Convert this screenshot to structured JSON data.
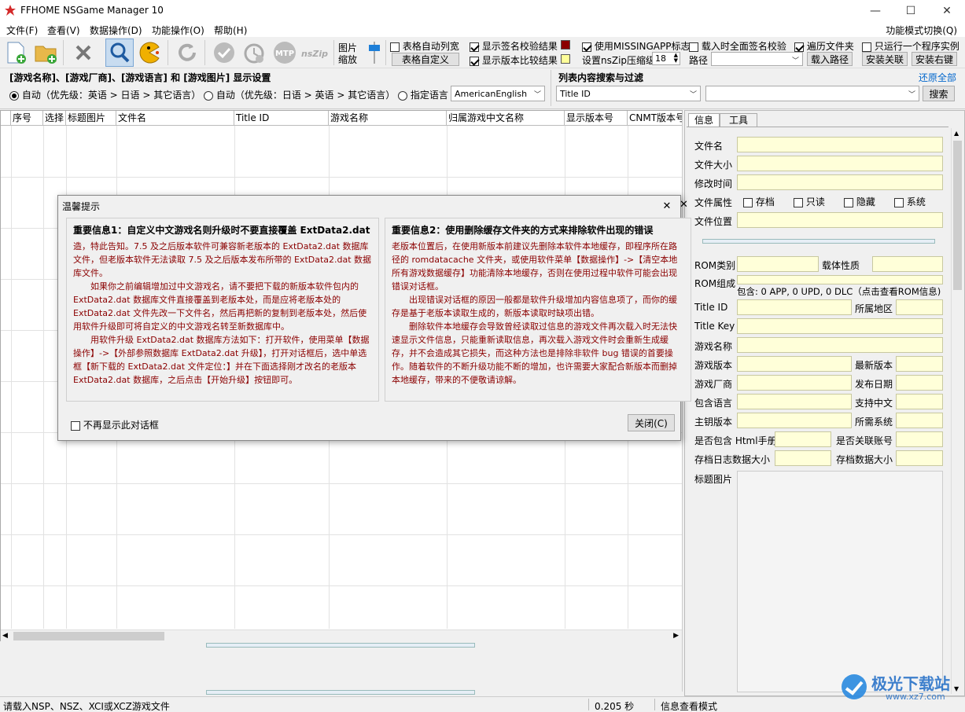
{
  "window": {
    "title": "FFHOME NSGame Manager 10",
    "minimize": "—",
    "maximize": "☐",
    "close": "✕"
  },
  "menu": {
    "items": [
      "文件(F)",
      "查看(V)",
      "数据操作(D)",
      "功能操作(O)",
      "帮助(H)"
    ],
    "mode_switch": "功能模式切换(Q)"
  },
  "toolbar": {
    "image_zoom_label_1": "图片",
    "image_zoom_label_2": "缩放",
    "auto_col_width": "表格自动列宽",
    "table_custom": "表格自定义",
    "show_sig_check": "显示签名校验结果",
    "show_version_compare": "显示版本比较结果",
    "use_missingapp": "使用MISSINGAPP标志",
    "nszip_level_label": "设置nsZip压缩级",
    "nszip_level_value": "18",
    "full_sig_check": "载入时全面签名校验",
    "traverse_folder": "遍历文件夹",
    "path_label": "路径",
    "load_path": "载入路径",
    "single_instance": "只运行一个程序实例",
    "install_assoc": "安装关联",
    "install_right_key": "安装右键",
    "colors": {
      "sig_box": "#8b0000",
      "ver_box": "#ffff99"
    }
  },
  "settings": {
    "display_title": "[游戏名称]、[游戏厂商]、[游戏语言] 和 [游戏图片] 显示设置",
    "radio_auto1": "自动（优先级：英语 > 日语 > 其它语言）",
    "radio_auto2": "自动（优先级：日语 > 英语 > 其它语言）",
    "radio_specify": "指定语言",
    "language_value": "AmericanEnglish",
    "search_title": "列表内容搜索与过滤",
    "restore_all": "还原全部",
    "search_field": "Title ID",
    "search_button": "搜索"
  },
  "table": {
    "columns": [
      "序号",
      "选择",
      "标题图片",
      "文件名",
      "Title ID",
      "游戏名称",
      "归属游戏中文名称",
      "显示版本号",
      "CNMT版本号"
    ]
  },
  "right_panel": {
    "tabs": [
      "信息",
      "工具"
    ],
    "file_name": "文件名",
    "file_size": "文件大小",
    "modified_time": "修改时间",
    "file_attr": "文件属性",
    "attr_archive": "存档",
    "attr_readonly": "只读",
    "attr_hidden": "隐藏",
    "attr_system": "系统",
    "file_location": "文件位置",
    "rom_type": "ROM类别",
    "media_type": "载体性质",
    "rom_composition": "ROM组成",
    "rom_contains": "包含: 0 APP, 0 UPD, 0 DLC（点击查看ROM信息)",
    "title_id": "Title ID",
    "region": "所属地区",
    "title_key": "Title Key",
    "game_name": "游戏名称",
    "game_version": "游戏版本",
    "latest_version": "最新版本",
    "game_vendor": "游戏厂商",
    "release_date": "发布日期",
    "languages": "包含语言",
    "chinese_support": "支持中文",
    "key_version": "主钥版本",
    "required_system": "所需系统",
    "html_manual": "是否包含 Html手册",
    "linked_account": "是否关联账号",
    "save_log_size": "存档日志数据大小",
    "save_data_size": "存档数据大小",
    "title_image": "标题图片"
  },
  "dialog": {
    "title": "温馨提示",
    "close_x": "✕",
    "info1_title": "重要信息1：自定义中文游戏名则升级时不要直接覆盖 ExtData2.dat",
    "info1_text": "造，特此告知。7.5 及之后版本软件可兼容新老版本的 ExtData2.dat 数据库文件，但老版本软件无法读取 7.5 及之后版本发布所带的 ExtData2.dat 数据库文件。\n　　如果你之前编辑增加过中文游戏名，请不要把下载的新版本软件包内的 ExtData2.dat 数据库文件直接覆盖到老版本处，而是应将老版本处的 ExtData2.dat 文件先改一下文件名，然后再把新的复制到老版本处，然后使用软件升级即可将自定义的中文游戏名转至新数据库中。\n　　用软件升级 ExtData2.dat 数据库方法如下：打开软件，使用菜单【数据操作】->【外部参照数据库 ExtData2.dat 升级】，打开对话框后，选中单选框【新下载的 ExtData2.dat 文件定位：】并在下面选择刚才改名的老版本 ExtData2.dat 数据库，之后点击【开始升级】按钮即可。",
    "info2_title": "重要信息2：使用删除缓存文件夹的方式来排除软件出现的错误",
    "info2_text": "老版本位置后，在使用新版本前建议先删除本软件本地缓存，即程序所在路径的 romdatacache 文件夹，或使用软件菜单【数据操作】->【清空本地所有游戏数据缓存】功能清除本地缓存，否则在使用过程中软件可能会出现错误对话框。\n　　出现错误对话框的原因一般都是软件升级增加内容信息项了，而你的缓存是基于老版本读取生成的，新版本读取时缺项出错。\n　　删除软件本地缓存会导致曾经读取过信息的游戏文件再次载入时无法快速显示文件信息，只能重新读取信息，再次载入游戏文件时会重新生成缓存，并不会造成其它损失，而这种方法也是排除非软件 bug 错误的首要操作。随着软件的不断升级功能不断的增加，也许需要大家配合新版本而删掉本地缓存，带来的不便敬请谅解。",
    "dont_show_again": "不再显示此对话框",
    "close_button": "关闭(C)"
  },
  "status": {
    "hint": "请载入NSP、NSZ、XCI或XCZ游戏文件",
    "time": "0.205 秒",
    "mode": "信息查看模式"
  },
  "watermark": {
    "text": "极光下载站",
    "url": "www.xz7.com"
  }
}
